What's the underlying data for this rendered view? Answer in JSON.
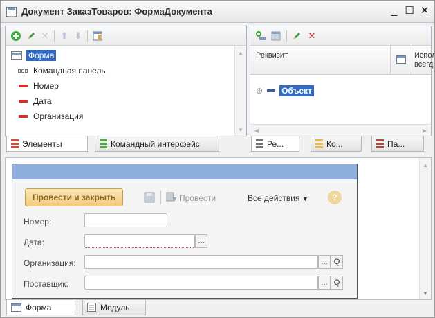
{
  "window": {
    "title": "Документ ЗаказТоваров: ФормаДокумента",
    "minimize": "_",
    "maximize": "☐",
    "close": "✕"
  },
  "elements_panel": {
    "toolbar_icons": [
      "add-icon",
      "edit-icon",
      "delete-icon",
      "move-up-icon",
      "move-down-icon",
      "panel-icon"
    ],
    "tree": [
      {
        "label": "Форма",
        "icon": "form-icon",
        "selected": true
      },
      {
        "label": "Командная панель",
        "icon": "command-panel-icon"
      },
      {
        "label": "Номер",
        "icon": "field-icon"
      },
      {
        "label": "Дата",
        "icon": "field-icon"
      },
      {
        "label": "Организация",
        "icon": "field-icon"
      }
    ],
    "tabs": [
      "Элементы",
      "Командный интерфейс"
    ]
  },
  "attributes_panel": {
    "toolbar_icons": [
      "add-attribute-icon",
      "add-table-icon",
      "edit-icon",
      "delete-icon"
    ],
    "header": {
      "col1": "Реквизит",
      "col3": "Испол всегд"
    },
    "rows": [
      {
        "label": "Объект",
        "expand": "⊕"
      }
    ],
    "tabs": [
      "Ре...",
      "Ко...",
      "Па..."
    ]
  },
  "preview_form": {
    "post_and_close": "Провести и закрыть",
    "post": "Провести",
    "all_actions": "Все действия",
    "help": "?",
    "fields": [
      {
        "label": "Номер:"
      },
      {
        "label": "Дата:",
        "button": "..."
      },
      {
        "label": "Организация:",
        "button": "...",
        "search": "Q"
      },
      {
        "label": "Поставщик:",
        "button": "...",
        "search": "Q"
      }
    ]
  },
  "bottom_tabs": [
    "Форма",
    "Модуль"
  ],
  "colors": {
    "accent": "#316ac5",
    "field_red": "#d6302b",
    "preview_header": "#8eaedd",
    "primary_button": "#f0cc7c"
  }
}
